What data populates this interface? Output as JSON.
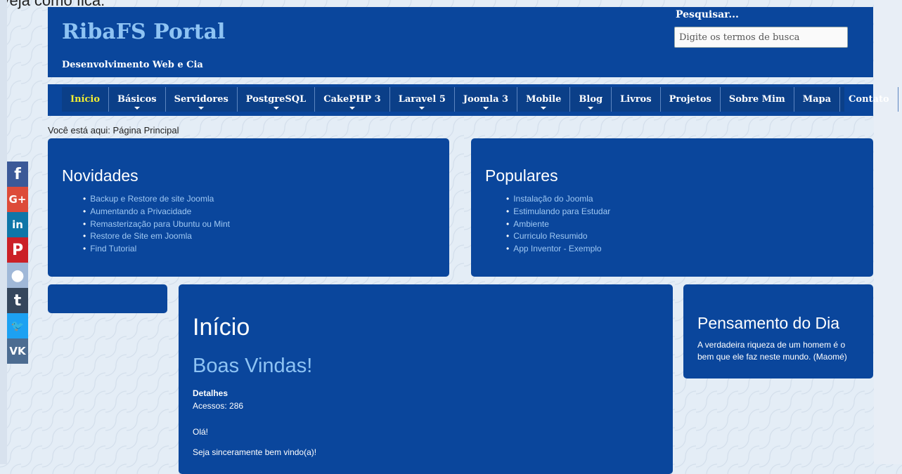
{
  "caption": "Veja como fica:",
  "header": {
    "site_title": "RibaFS Portal",
    "site_description": "Desenvolvimento Web e Cia",
    "search_label": "Pesquisar...",
    "search_placeholder": "Digite os termos de busca"
  },
  "nav": {
    "items": [
      {
        "label": "Início",
        "active": true,
        "has_dropdown": false
      },
      {
        "label": "Básicos",
        "has_dropdown": true
      },
      {
        "label": "Servidores",
        "has_dropdown": true
      },
      {
        "label": "PostgreSQL",
        "has_dropdown": true
      },
      {
        "label": "CakePHP 3",
        "has_dropdown": true
      },
      {
        "label": "Laravel 5",
        "has_dropdown": true
      },
      {
        "label": "Joomla 3",
        "has_dropdown": true
      },
      {
        "label": "Mobile",
        "has_dropdown": true
      },
      {
        "label": "Blog",
        "has_dropdown": true
      },
      {
        "label": "Livros",
        "has_dropdown": false
      },
      {
        "label": "Projetos",
        "has_dropdown": false
      },
      {
        "label": "Sobre Mim",
        "has_dropdown": false
      },
      {
        "label": "Mapa",
        "has_dropdown": false
      },
      {
        "label": "Contato",
        "has_dropdown": false
      }
    ]
  },
  "breadcrumb": "Você está aqui: Página Principal",
  "modules": {
    "novidades": {
      "title": "Novidades",
      "items": [
        "Backup e Restore de site Joomla",
        "Aumentando a Privacidade",
        "Remasterização para Ubuntu ou Mint",
        "Restore de Site em Joomla",
        "Find Tutorial"
      ]
    },
    "populares": {
      "title": "Populares",
      "items": [
        "Instalação do Joomla",
        "Estimulando para Estudar",
        "Ambiente",
        "Curriculo Resumido",
        "App Inventor - Exemplo"
      ]
    }
  },
  "article": {
    "title": "Início",
    "subtitle": "Boas Vindas!",
    "details_label": "Detalhes",
    "hits": "Acessos: 286",
    "paragraph1": "Olá!",
    "paragraph2": "Seja sinceramente bem vindo(a)!"
  },
  "thought": {
    "title": "Pensamento do Dia",
    "text": "A verdadeira riqueza de um homem é o bem que ele faz neste mundo. (Maomé)"
  },
  "social": {
    "buttons": [
      {
        "name": "facebook-icon",
        "glyph": "f",
        "color": "#3b5998"
      },
      {
        "name": "google-plus-icon",
        "glyph": "G+",
        "color": "#dd4b39"
      },
      {
        "name": "linkedin-icon",
        "glyph": "in",
        "color": "#0e76a8"
      },
      {
        "name": "pinterest-icon",
        "glyph": "P",
        "color": "#cb2027"
      },
      {
        "name": "reddit-icon",
        "glyph": "●",
        "color": "#a0b8d8"
      },
      {
        "name": "tumblr-icon",
        "glyph": "t",
        "color": "#35465c"
      },
      {
        "name": "twitter-icon",
        "glyph": "🐦",
        "color": "#1da1f2"
      },
      {
        "name": "vk-icon",
        "glyph": "VK",
        "color": "#4c6c91"
      }
    ]
  },
  "colors": {
    "primary": "#0a469c",
    "title_light": "#8ec3f3",
    "active_nav": "#f4ee30",
    "link": "#9fc8f3"
  }
}
